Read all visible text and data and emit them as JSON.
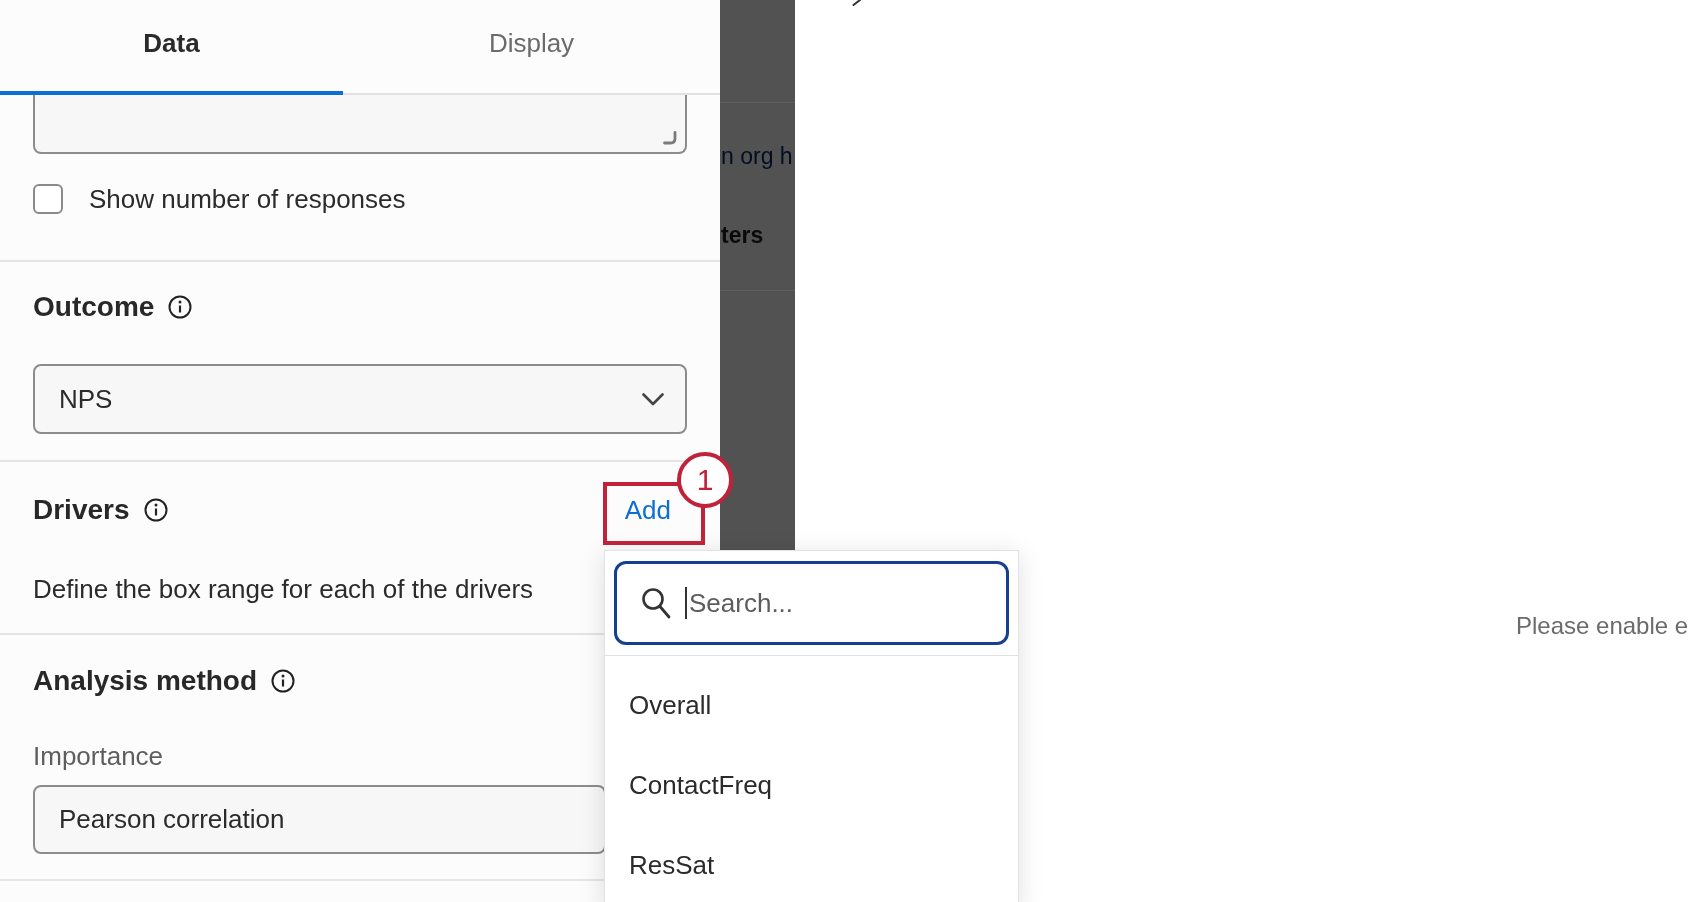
{
  "tabs": [
    {
      "label": "Data",
      "selected": true
    },
    {
      "label": "Display",
      "selected": false
    }
  ],
  "show_responses": {
    "label": "Show number of responses",
    "checked": false
  },
  "outcome": {
    "title": "Outcome",
    "value": "NPS"
  },
  "drivers": {
    "title": "Drivers",
    "action": "Add",
    "description": "Define the box range for each of the drivers"
  },
  "analysis_method": {
    "title": "Analysis method",
    "label": "Importance",
    "value": "Pearson correlation"
  },
  "background_texts": [
    {
      "text": "n org h",
      "kind": "link"
    },
    {
      "text": "ters",
      "kind": "heading"
    }
  ],
  "right_pane": {
    "notice": "Please enable e"
  },
  "driver_menu": {
    "placeholder": "Search...",
    "options": [
      {
        "label": "Overall",
        "selected": false
      },
      {
        "label": "ContactFreq",
        "selected": false
      },
      {
        "label": "ResSat",
        "selected": false
      }
    ]
  },
  "annotation": {
    "number": "1"
  }
}
